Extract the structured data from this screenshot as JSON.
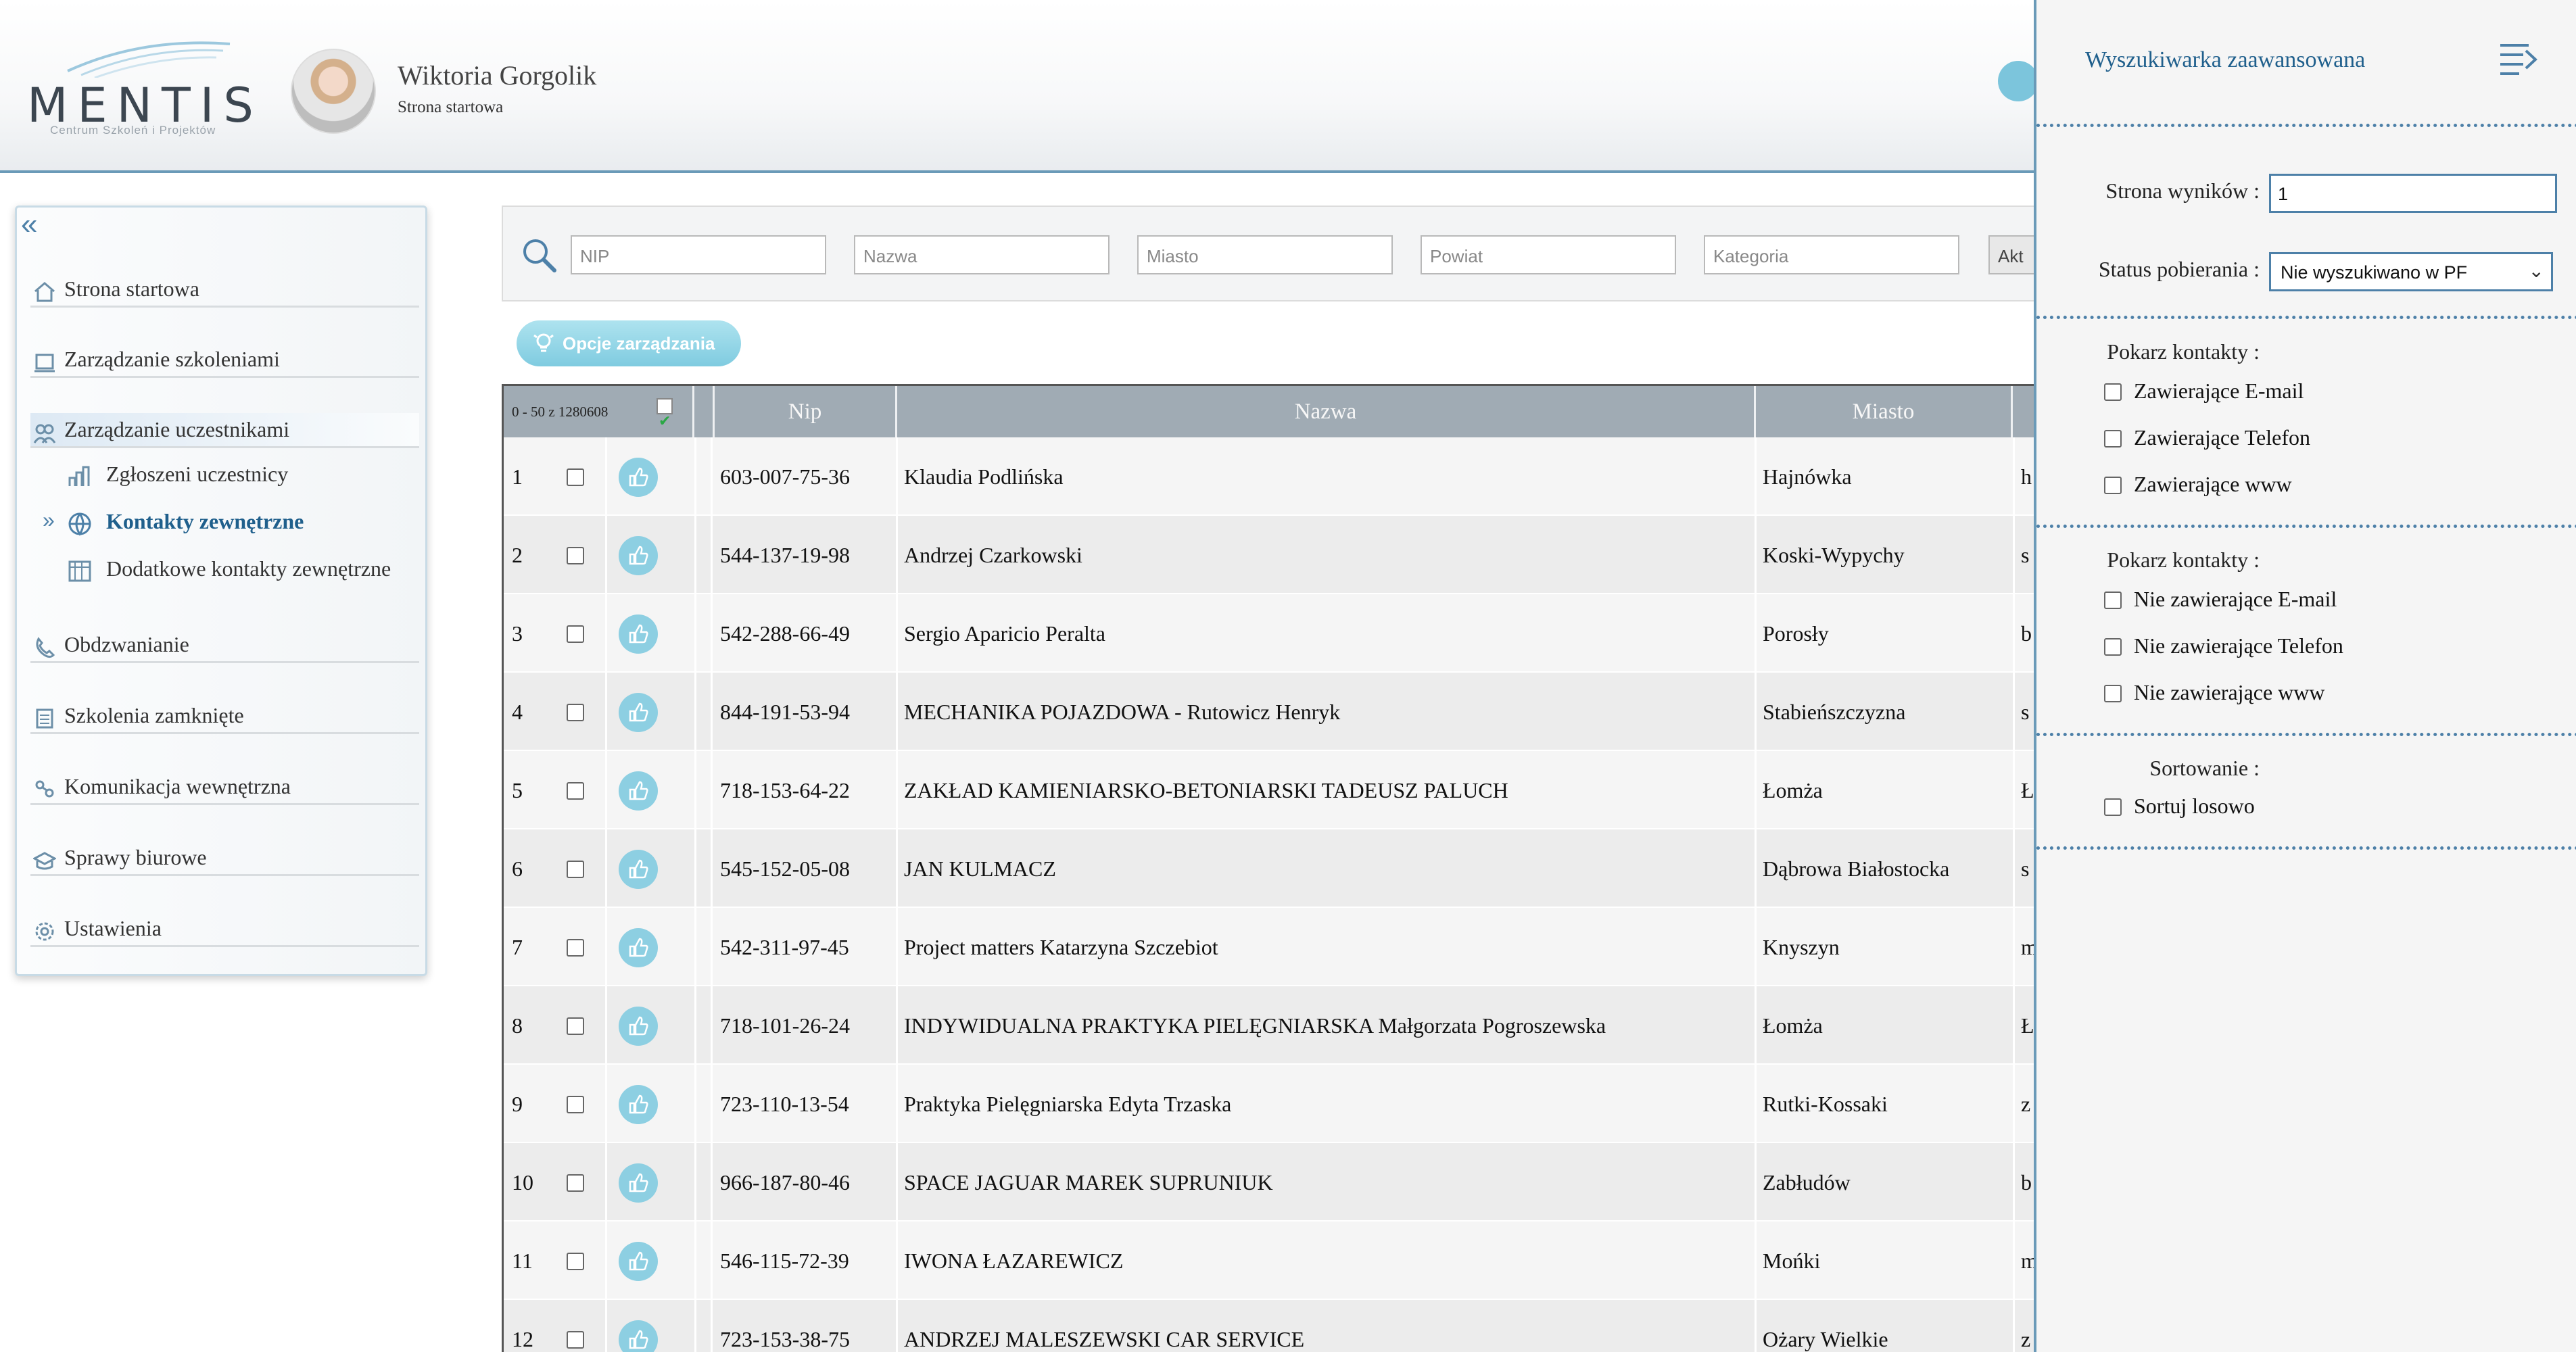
{
  "header": {
    "logo": {
      "wordmark": "MENTIS",
      "tagline": "Centrum Szkoleń i Projektów"
    },
    "user": {
      "name": "Wiktoria Gorgolik",
      "subtitle": "Strona startowa"
    }
  },
  "sidebar": {
    "items": [
      {
        "label": "Strona startowa",
        "icon": "home-icon"
      },
      {
        "label": "Zarządzanie szkoleniami",
        "icon": "book-icon"
      },
      {
        "label": "Zarządzanie uczestnikami",
        "icon": "people-icon"
      },
      {
        "label": "Obdzwanianie",
        "icon": "phone-icon"
      },
      {
        "label": "Szkolenia zamknięte",
        "icon": "briefcase-icon"
      },
      {
        "label": "Komunikacja wewnętrzna",
        "icon": "chat-icon"
      },
      {
        "label": "Sprawy biurowe",
        "icon": "office-icon"
      },
      {
        "label": "Ustawienia",
        "icon": "gear-icon"
      }
    ],
    "subitems": [
      {
        "label": "Zgłoszeni uczestnicy",
        "icon": "chart-icon"
      },
      {
        "label": "Kontakty zewnętrzne",
        "icon": "globe-icon"
      },
      {
        "label": "Dodatkowe kontakty zewnętrzne",
        "icon": "calendar-icon"
      }
    ]
  },
  "filters": {
    "nip": "NIP",
    "nazwa": "Nazwa",
    "miasto": "Miasto",
    "powiat": "Powiat",
    "kategoria": "Kategoria",
    "action": "Akt"
  },
  "manage_button": "Opcje zarządzania",
  "table": {
    "count": "0 - 50 z 1280608",
    "headers": {
      "nip": "Nip",
      "nazwa": "Nazwa",
      "miasto": "Miasto"
    },
    "rows": [
      {
        "n": "1",
        "nip": "603-007-75-36",
        "nazwa": "Klaudia Podlińska",
        "miasto": "Hajnówka",
        "extra": "h"
      },
      {
        "n": "2",
        "nip": "544-137-19-98",
        "nazwa": "Andrzej Czarkowski",
        "miasto": "Koski-Wypychy",
        "extra": "s"
      },
      {
        "n": "3",
        "nip": "542-288-66-49",
        "nazwa": "Sergio Aparicio Peralta",
        "miasto": "Porosły",
        "extra": "b"
      },
      {
        "n": "4",
        "nip": "844-191-53-94",
        "nazwa": "MECHANIKA POJAZDOWA - Rutowicz Henryk",
        "miasto": "Stabieńszczyzna",
        "extra": "s"
      },
      {
        "n": "5",
        "nip": "718-153-64-22",
        "nazwa": "ZAKŁAD KAMIENIARSKO-BETONIARSKI TADEUSZ PALUCH",
        "miasto": "Łomża",
        "extra": "Ł"
      },
      {
        "n": "6",
        "nip": "545-152-05-08",
        "nazwa": "JAN KULMACZ",
        "miasto": "Dąbrowa Białostocka",
        "extra": "s"
      },
      {
        "n": "7",
        "nip": "542-311-97-45",
        "nazwa": "Project matters Katarzyna Szczebiot",
        "miasto": "Knyszyn",
        "extra": "m"
      },
      {
        "n": "8",
        "nip": "718-101-26-24",
        "nazwa": "INDYWIDUALNA PRAKTYKA PIELĘGNIARSKA Małgorzata Pogroszewska",
        "miasto": "Łomża",
        "extra": "Ł"
      },
      {
        "n": "9",
        "nip": "723-110-13-54",
        "nazwa": "Praktyka Pielęgniarska Edyta Trzaska",
        "miasto": "Rutki-Kossaki",
        "extra": "z"
      },
      {
        "n": "10",
        "nip": "966-187-80-46",
        "nazwa": "SPACE JAGUAR MAREK SUPRUNIUK",
        "miasto": "Zabłudów",
        "extra": "b"
      },
      {
        "n": "11",
        "nip": "546-115-72-39",
        "nazwa": "IWONA ŁAZAREWICZ",
        "miasto": "Mońki",
        "extra": "m"
      },
      {
        "n": "12",
        "nip": "723-153-38-75",
        "nazwa": "ANDRZEJ MALESZEWSKI CAR SERVICE",
        "miasto": "Ożary Wielkie",
        "extra": "z"
      }
    ]
  },
  "panel": {
    "title": "Wyszukiwarka zaawansowana",
    "page_label": "Strona wyników :",
    "page_value": "1",
    "status_label": "Status pobierania :",
    "status_value": "Nie wyszukiwano w PF",
    "show_contacts_1": "Pokarz kontakty :",
    "with_email": "Zawierające E-mail",
    "with_phone": "Zawierające Telefon",
    "with_www": "Zawierające www",
    "show_contacts_2": "Pokarz kontakty :",
    "without_email": "Nie zawierające E-mail",
    "without_phone": "Nie zawierające Telefon",
    "without_www": "Nie zawierające www",
    "sort_label": "Sortowanie :",
    "sort_random": "Sortuj losowo"
  },
  "colors": {
    "accent": "#1f5f8c",
    "header_border": "#6a9ab8",
    "like": "#8dcfe2",
    "table_header": "#a0abb4"
  }
}
